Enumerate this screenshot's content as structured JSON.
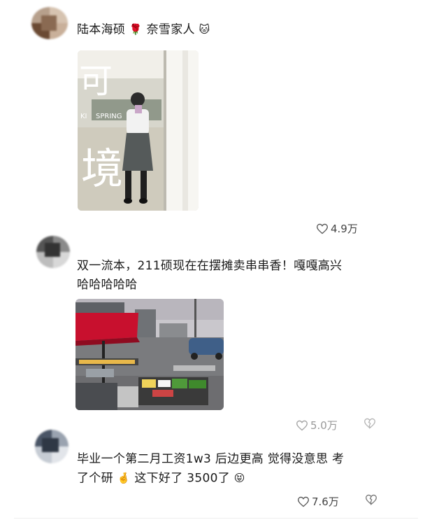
{
  "comments": [
    {
      "text": "陆本海硕",
      "emoji_1": "🌹",
      "text_2": "奈雪家人",
      "emoji_2": "🐱",
      "likes": "4.9万",
      "photo": {
        "sign_text_1": "KI",
        "sign_text_2": "SPRING"
      }
    },
    {
      "text_line_1": "双一流本，211硕现在在摆摊卖串串香！嘎嘎高兴",
      "text_line_2": "哈哈哈哈哈",
      "likes": "5.0万"
    },
    {
      "text_line_1": "毕业一个第二月工资1w3 后边更高 觉得没意思 考",
      "text_line_2_a": "了个研",
      "emoji_1": "🤞",
      "text_line_2_b": "这下好了 3500了",
      "emoji_2": "😝",
      "likes": "7.6万"
    }
  ],
  "icons": {
    "like": "heart-outline-icon",
    "dislike": "broken-heart-icon"
  },
  "colors": {
    "text": "#1a1a1a",
    "meta": "#444444",
    "umbrella": "#c8102e"
  }
}
